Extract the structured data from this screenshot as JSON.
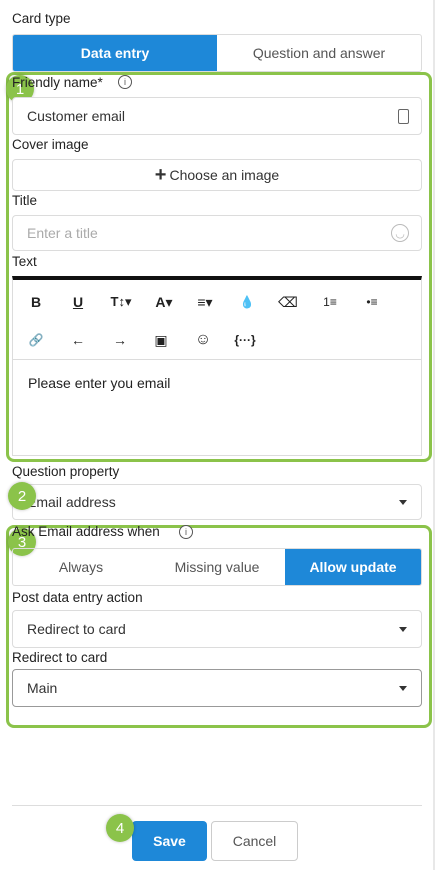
{
  "card_type": {
    "label": "Card type",
    "tabs": [
      {
        "label": "Data entry",
        "active": true
      },
      {
        "label": "Question and answer",
        "active": false
      }
    ]
  },
  "friendly_name": {
    "label": "Friendly name*",
    "info_icon": "info-icon",
    "value": "Customer email",
    "icon": "id-card-icon"
  },
  "cover_image": {
    "label": "Cover image",
    "button_label": "Choose an image",
    "plus": "+"
  },
  "title_field": {
    "label": "Title",
    "placeholder": "Enter a title",
    "icon": "emoji-icon"
  },
  "text_field": {
    "label": "Text",
    "toolbar_row1": [
      {
        "name": "bold-icon",
        "glyph": "B"
      },
      {
        "name": "underline-icon",
        "glyph": "U"
      },
      {
        "name": "text-size-icon",
        "glyph": "T↕▾"
      },
      {
        "name": "font-color-icon",
        "glyph": "A▾"
      },
      {
        "name": "align-icon",
        "glyph": "≡▾"
      },
      {
        "name": "highlight-icon",
        "glyph": "💧"
      },
      {
        "name": "eraser-icon",
        "glyph": "⌫"
      },
      {
        "name": "ordered-list-icon",
        "glyph": "1≡"
      },
      {
        "name": "bullet-list-icon",
        "glyph": "•≡"
      }
    ],
    "toolbar_row2": [
      {
        "name": "link-icon",
        "glyph": "🔗"
      },
      {
        "name": "undo-icon",
        "glyph": "←"
      },
      {
        "name": "redo-icon",
        "glyph": "→"
      },
      {
        "name": "image-icon",
        "glyph": "▣"
      },
      {
        "name": "emoji-icon",
        "glyph": "☺"
      },
      {
        "name": "variable-icon",
        "glyph": "{···}"
      }
    ],
    "content": "Please enter you email"
  },
  "question_property": {
    "label": "Question property",
    "value": "Email address"
  },
  "ask_when": {
    "label": "Ask Email address when",
    "info_icon": "info-icon",
    "options": [
      {
        "label": "Always",
        "active": false
      },
      {
        "label": "Missing value",
        "active": false
      },
      {
        "label": "Allow update",
        "active": true
      }
    ]
  },
  "post_action": {
    "label": "Post data entry action",
    "value": "Redirect to card"
  },
  "redirect": {
    "label": "Redirect to card",
    "value": "Main"
  },
  "footer": {
    "save_label": "Save",
    "cancel_label": "Cancel"
  },
  "badges": [
    "1",
    "2",
    "3",
    "4"
  ],
  "colors": {
    "accent": "#1e88d8",
    "highlight": "#8bc34a"
  }
}
